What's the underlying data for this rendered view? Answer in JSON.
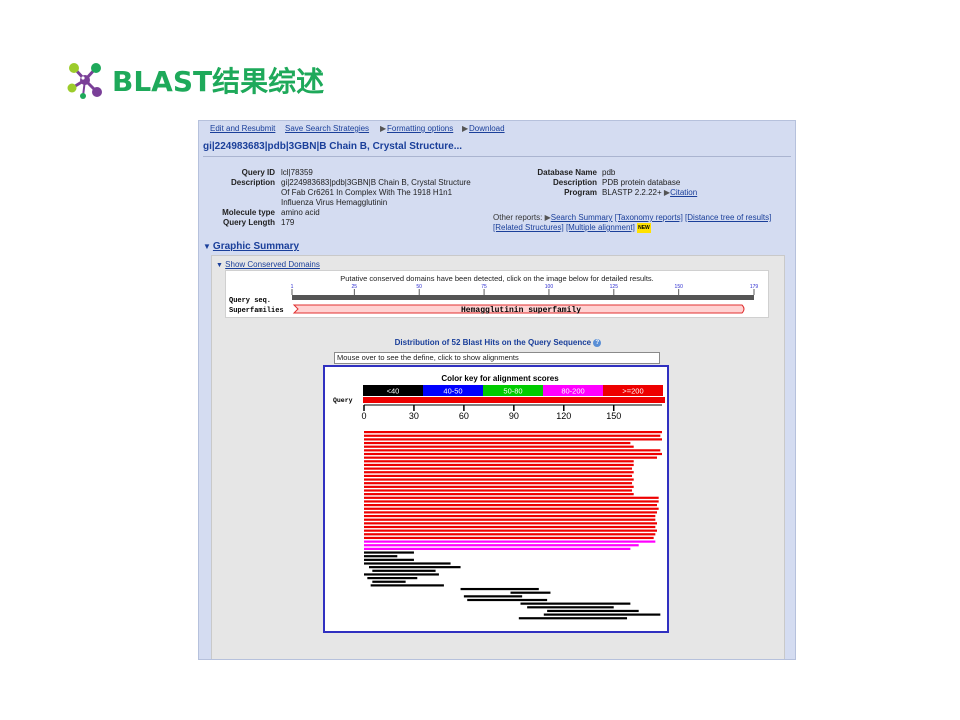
{
  "slide": {
    "title": "BLAST结果综述"
  },
  "links": {
    "edit_resubmit": "Edit and Resubmit",
    "save_strategies": "Save Search Strategies",
    "formatting": "Formatting options",
    "download": "Download"
  },
  "hit_title": "gi|224983683|pdb|3GBN|B Chain B, Crystal Structure...",
  "query": {
    "id_label": "Query ID",
    "id": "lcl|78359",
    "desc_label": "Description",
    "desc_lines": [
      "gi|224983683|pdb|3GBN|B Chain B, Crystal Structure",
      "Of Fab Cr6261 In Complex With The 1918 H1n1",
      "Influenza Virus Hemagglutinin"
    ],
    "moltype_label": "Molecule type",
    "moltype": "amino acid",
    "len_label": "Query Length",
    "len": "179"
  },
  "database": {
    "name_label": "Database Name",
    "name": "pdb",
    "desc_label": "Description",
    "desc": "PDB protein database",
    "program_label": "Program",
    "program": "BLASTP 2.2.22+",
    "citation": "Citation"
  },
  "reports": {
    "prefix": "Other reports:",
    "search_summary": "Search Summary",
    "taxonomy": "[Taxonomy reports]",
    "distance_tree": "[Distance tree of results]",
    "related": "[Related Structures]",
    "multiple": "[Multiple alignment]",
    "new_badge": "NEW"
  },
  "graphic_summary": {
    "heading": "Graphic Summary",
    "show_cd": "Show Conserved Domains",
    "cd_notice": "Putative conserved domains have been detected, click on the image below for detailed results.",
    "query_seq_label": "Query seq.",
    "superfamilies_label": "Superfamilies",
    "superfamily_name": "Hemagglutinin superfamily",
    "ruler_ticks": [
      "1",
      "25",
      "50",
      "75",
      "100",
      "125",
      "150",
      "179"
    ],
    "dist_title": "Distribution of 52 Blast Hits on the Query Sequence",
    "mouse_over": "Mouse over to see the define, click to show alignments"
  },
  "chart_data": {
    "type": "bar",
    "title": "Color key for alignment scores",
    "color_key": [
      {
        "label": "<40",
        "color": "#000000"
      },
      {
        "label": "40-50",
        "color": "#0000ff"
      },
      {
        "label": "50-80",
        "color": "#00cc00"
      },
      {
        "label": "80-200",
        "color": "#ff00ff"
      },
      {
        "label": ">=200",
        "color": "#ee0000"
      }
    ],
    "query_label": "Query",
    "xticks": [
      0,
      30,
      60,
      90,
      120,
      150
    ],
    "xlim": [
      0,
      179
    ],
    "hits": [
      {
        "start": 0,
        "end": 179,
        "score": ">=200"
      },
      {
        "start": 0,
        "end": 178,
        "score": ">=200"
      },
      {
        "start": 0,
        "end": 179,
        "score": ">=200"
      },
      {
        "start": 0,
        "end": 160,
        "score": ">=200"
      },
      {
        "start": 0,
        "end": 162,
        "score": ">=200"
      },
      {
        "start": 0,
        "end": 178,
        "score": ">=200"
      },
      {
        "start": 0,
        "end": 179,
        "score": ">=200"
      },
      {
        "start": 0,
        "end": 176,
        "score": ">=200"
      },
      {
        "start": 0,
        "end": 162,
        "score": ">=200"
      },
      {
        "start": 0,
        "end": 162,
        "score": ">=200"
      },
      {
        "start": 0,
        "end": 161,
        "score": ">=200"
      },
      {
        "start": 0,
        "end": 162,
        "score": ">=200"
      },
      {
        "start": 0,
        "end": 161,
        "score": ">=200"
      },
      {
        "start": 0,
        "end": 162,
        "score": ">=200"
      },
      {
        "start": 0,
        "end": 161,
        "score": ">=200"
      },
      {
        "start": 0,
        "end": 162,
        "score": ">=200"
      },
      {
        "start": 0,
        "end": 161,
        "score": ">=200"
      },
      {
        "start": 0,
        "end": 162,
        "score": ">=200"
      },
      {
        "start": 0,
        "end": 177,
        "score": ">=200"
      },
      {
        "start": 0,
        "end": 177,
        "score": ">=200"
      },
      {
        "start": 0,
        "end": 176,
        "score": ">=200"
      },
      {
        "start": 0,
        "end": 177,
        "score": ">=200"
      },
      {
        "start": 0,
        "end": 176,
        "score": ">=200"
      },
      {
        "start": 0,
        "end": 175,
        "score": ">=200"
      },
      {
        "start": 0,
        "end": 175,
        "score": ">=200"
      },
      {
        "start": 0,
        "end": 176,
        "score": ">=200"
      },
      {
        "start": 0,
        "end": 175,
        "score": ">=200"
      },
      {
        "start": 0,
        "end": 176,
        "score": ">=200"
      },
      {
        "start": 0,
        "end": 175,
        "score": ">=200"
      },
      {
        "start": 0,
        "end": 174,
        "score": ">=200"
      },
      {
        "start": 0,
        "end": 175,
        "score": "80-200"
      },
      {
        "start": 0,
        "end": 165,
        "score": "80-200"
      },
      {
        "start": 0,
        "end": 160,
        "score": "80-200"
      },
      {
        "start": 0,
        "end": 30,
        "score": "<40"
      },
      {
        "start": 0,
        "end": 20,
        "score": "<40"
      },
      {
        "start": 0,
        "end": 30,
        "score": "<40"
      },
      {
        "start": 0,
        "end": 52,
        "score": "<40"
      },
      {
        "start": 3,
        "end": 58,
        "score": "<40"
      },
      {
        "start": 5,
        "end": 43,
        "score": "<40"
      },
      {
        "start": 0,
        "end": 45,
        "score": "<40"
      },
      {
        "start": 2,
        "end": 32,
        "score": "<40"
      },
      {
        "start": 5,
        "end": 25,
        "score": "<40"
      },
      {
        "start": 4,
        "end": 48,
        "score": "<40"
      },
      {
        "start": 58,
        "end": 105,
        "score": "<40"
      },
      {
        "start": 88,
        "end": 112,
        "score": "<40"
      },
      {
        "start": 60,
        "end": 95,
        "score": "<40"
      },
      {
        "start": 62,
        "end": 110,
        "score": "<40"
      },
      {
        "start": 94,
        "end": 160,
        "score": "<40"
      },
      {
        "start": 98,
        "end": 150,
        "score": "<40"
      },
      {
        "start": 110,
        "end": 165,
        "score": "<40"
      },
      {
        "start": 108,
        "end": 178,
        "score": "<40"
      },
      {
        "start": 93,
        "end": 158,
        "score": "<40"
      }
    ]
  }
}
